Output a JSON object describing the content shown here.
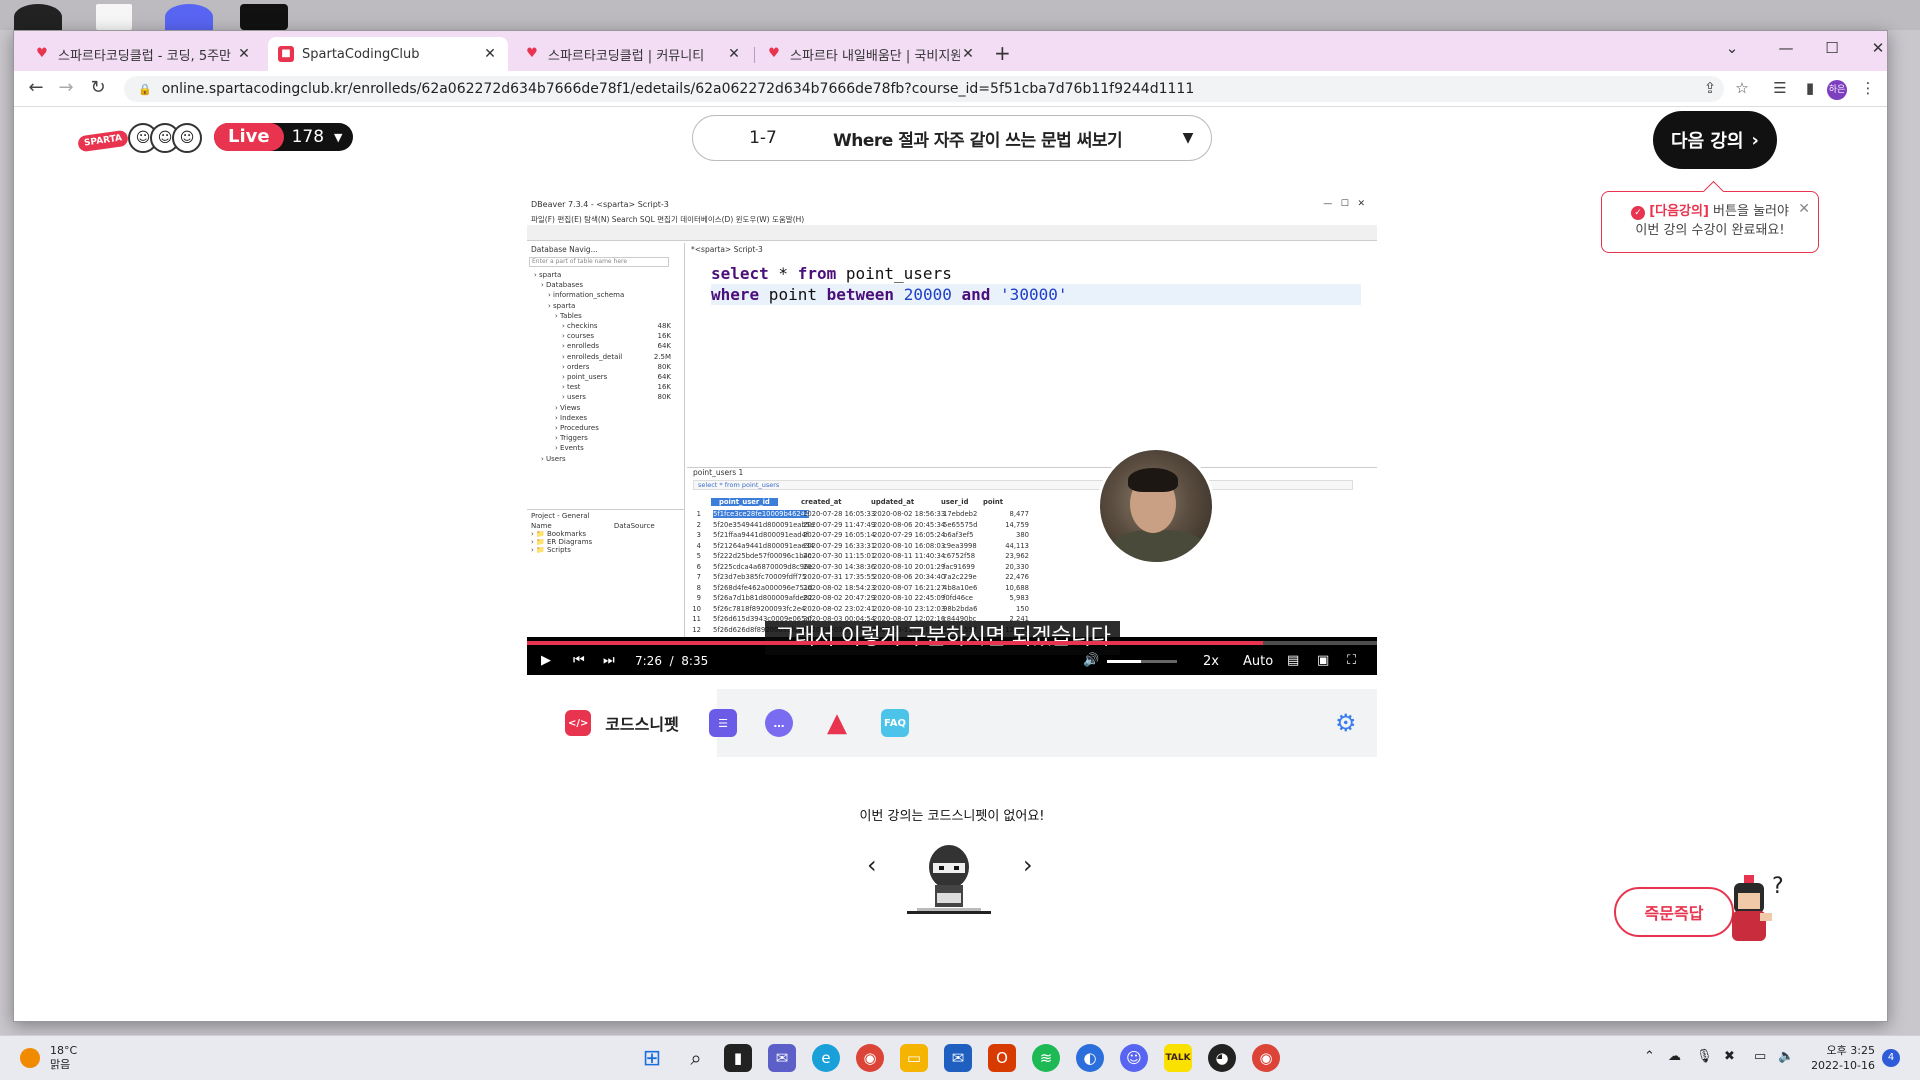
{
  "browser": {
    "tabs": [
      {
        "label": "스파르타코딩클럽 - 코딩, 5주만",
        "active": false
      },
      {
        "label": "SpartaCodingClub",
        "active": true
      },
      {
        "label": "스파르타코딩클럽 | 커뮤니티",
        "active": false
      },
      {
        "label": "스파르타 내일배움단 | 국비지원",
        "active": false
      }
    ],
    "url": "online.spartacodingclub.kr/enrolleds/62a062272d634b7666de78f1/edetails/62a062272d634b7666de78fb?course_id=5f51cba7d76b11f9244d1111",
    "profile_label": "하은"
  },
  "header": {
    "logo": "SPARTA",
    "live_label": "Live",
    "live_count": "178",
    "lecture_number": "1-7",
    "lecture_title": "Where 절과 자주 같이 쓰는 문법 써보기",
    "next_button": "다음 강의",
    "tooltip_highlight": "[다음강의]",
    "tooltip_text1": " 버튼을 눌러야",
    "tooltip_text2": "이번 강의 수강이 완료돼요!"
  },
  "video": {
    "dbeaver_title": "DBeaver 7.3.4 - <sparta> Script-3",
    "menu": "파일(F)  편집(E)  탐색(N)  Search  SQL 편집기  데이터베이스(D)  윈도우(W)  도움말(H)",
    "editor_tab": "*<sparta> Script-3",
    "nav_title": "Database Navig...",
    "nav_search": "Enter a part of table name here",
    "tree": [
      {
        "label": "sparta",
        "size": "",
        "indent": 1
      },
      {
        "label": "Databases",
        "size": "",
        "indent": 2
      },
      {
        "label": "information_schema",
        "size": "",
        "indent": 3
      },
      {
        "label": "sparta",
        "size": "",
        "indent": 3
      },
      {
        "label": "Tables",
        "size": "",
        "indent": 4
      },
      {
        "label": "checkins",
        "size": "48K",
        "indent": 5
      },
      {
        "label": "courses",
        "size": "16K",
        "indent": 5
      },
      {
        "label": "enrolleds",
        "size": "64K",
        "indent": 5
      },
      {
        "label": "enrolleds_detail",
        "size": "2.5M",
        "indent": 5
      },
      {
        "label": "orders",
        "size": "80K",
        "indent": 5
      },
      {
        "label": "point_users",
        "size": "64K",
        "indent": 5
      },
      {
        "label": "test",
        "size": "16K",
        "indent": 5
      },
      {
        "label": "users",
        "size": "80K",
        "indent": 5
      },
      {
        "label": "Views",
        "size": "",
        "indent": 4
      },
      {
        "label": "Indexes",
        "size": "",
        "indent": 4
      },
      {
        "label": "Procedures",
        "size": "",
        "indent": 4
      },
      {
        "label": "Triggers",
        "size": "",
        "indent": 4
      },
      {
        "label": "Events",
        "size": "",
        "indent": 4
      },
      {
        "label": "Users",
        "size": "",
        "indent": 2
      }
    ],
    "project_title": "Project - General",
    "project_cols": [
      "Name",
      "DataSource"
    ],
    "project_items": [
      "Bookmarks",
      "ER Diagrams",
      "Scripts"
    ],
    "code_line1": {
      "kw1": "select",
      "rest1": " * ",
      "kw2": "from",
      "rest2": " point_users"
    },
    "code_line2": {
      "kw1": "where",
      "rest1": " point ",
      "kw2": "between",
      "num": "20000",
      "kw3": "and",
      "str": "'30000'"
    },
    "results_tab": "point_users 1",
    "results_filter": "select * from point_users",
    "columns": [
      "point_user_id",
      "created_at",
      "updated_at",
      "user_id",
      "point"
    ],
    "rows": [
      [
        "1",
        "5f1fce3ce28fe10009b46244",
        "2020-07-28 16:05:33",
        "2020-08-02 18:56:33",
        "17ebdeb2",
        "8,477"
      ],
      [
        "2",
        "5f20e3549441d800091eab5e",
        "2020-07-29 11:47:49",
        "2020-08-06 20:45:34",
        "5e65575d",
        "14,759"
      ],
      [
        "3",
        "5f21ffaa9441d800091ead4f",
        "2020-07-29 16:05:14",
        "2020-07-29 16:05:24",
        "b6af3ef5",
        "380"
      ],
      [
        "4",
        "5f21264a9441d800091eae34",
        "2020-07-29 16:33:31",
        "2020-08-10 16:08:03",
        "c9ea3998",
        "44,113"
      ],
      [
        "5",
        "5f222d25bde57f00096c1b4c",
        "2020-07-30 11:15:01",
        "2020-08-11 11:40:34",
        "c6752f58",
        "23,962"
      ],
      [
        "6",
        "5f225cdca4a6870009d8c96e",
        "2020-07-30 14:38:36",
        "2020-08-10 20:01:29",
        "fac91699",
        "20,330"
      ],
      [
        "7",
        "5f23d7eb385fc70009fdff75",
        "2020-07-31 17:35:55",
        "2020-08-06 20:34:40",
        "7a2c229e",
        "22,476"
      ],
      [
        "8",
        "5f268d4fe462a000096e751d",
        "2020-08-02 18:54:23",
        "2020-08-07 16:21:27",
        "4b8a10e6",
        "10,688"
      ],
      [
        "9",
        "5f26a7d1b81d800009afde82",
        "2020-08-02 20:47:29",
        "2020-08-10 22:45:09",
        "f0fd46ce",
        "5,983"
      ],
      [
        "10",
        "5f26c7818f89200093fc2e4",
        "2020-08-02 23:02:41",
        "2020-08-10 23:12:03",
        "98b2bda6",
        "150"
      ],
      [
        "11",
        "5f26d615d3943c0009e065af",
        "2020-08-03 00:04:54",
        "2020-08-07 12:02:16",
        "c84490bc",
        "2,241"
      ],
      [
        "12",
        "5f26d626d8f89200093fc345",
        "2020-08-03 00:05:10",
        "2020-08-11 02:01:21",
        "25c45557",
        "12,694"
      ]
    ],
    "caption": "그래서 이렇게 구분하시면 되겠습니다",
    "time_current": "7:26",
    "time_separator": "/",
    "time_total": "8:35",
    "progress_fraction": 0.866,
    "speed": "2x",
    "quality": "Auto"
  },
  "snippet": {
    "active_tab": "코드스니펫",
    "faq_label": "FAQ",
    "empty_message": "이번 강의는 코드스니펫이 없어요!",
    "qa_button": "즉문즉답"
  },
  "taskbar": {
    "temperature": "18°C",
    "weather": "맑음",
    "time": "오후 3:25",
    "date": "2022-10-16",
    "notifications": "4"
  },
  "colors": {
    "brand": "#e8344e",
    "tab_bar": "#f2ddf5",
    "gear": "#3a7df0"
  }
}
